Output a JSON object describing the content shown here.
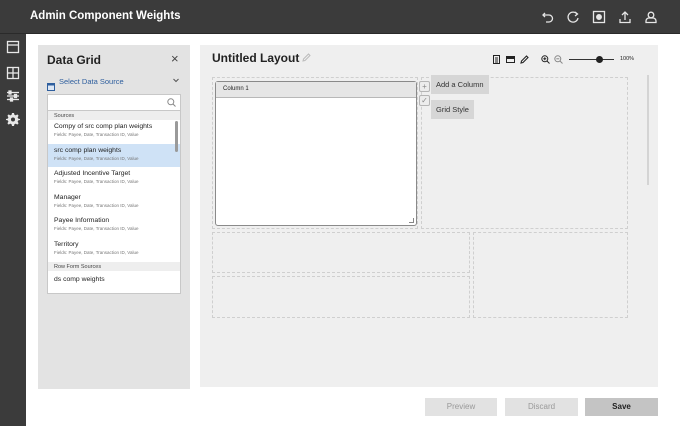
{
  "app": {
    "title": "Admin Component Weights"
  },
  "topbar_icons": [
    "undo-icon",
    "redo-icon",
    "record-icon",
    "upload-icon",
    "user-icon"
  ],
  "rail_icons": [
    "layout-icon",
    "grid-icon",
    "sliders-icon",
    "settings-icon"
  ],
  "panel": {
    "title": "Data Grid",
    "close_glyph": "×",
    "select_source_label": "Select Data Source",
    "search": {
      "value": "",
      "placeholder": ""
    },
    "sections": [
      {
        "header": "Sources",
        "items": [
          {
            "title": "Compy of src comp plan weights",
            "fields": "Fields: Payee, Date, Transaction ID, Value",
            "selected": false
          },
          {
            "title": "src comp plan weights",
            "fields": "Fields: Payee, Date, Transaction ID, Value",
            "selected": true
          },
          {
            "title": "Adjusted Incentive Target",
            "fields": "Fields: Payee, Date, Transaction ID, Value",
            "selected": false
          },
          {
            "title": "Manager",
            "fields": "Fields: Payee, Date, Transaction ID, Value",
            "selected": false
          },
          {
            "title": "Payee Information",
            "fields": "Fields: Payee, Date, Transaction ID, Value",
            "selected": false
          },
          {
            "title": "Territory",
            "fields": "Fields: Payee, Date, Transaction ID, Value",
            "selected": false
          }
        ]
      },
      {
        "header": "Row Form Sources",
        "items": [
          {
            "title": "ds comp weights"
          }
        ]
      }
    ]
  },
  "layout": {
    "title": "Untitled Layout",
    "toolbar_icons": [
      "document-icon",
      "card-icon",
      "pencil-icon",
      "zoom-in-icon",
      "zoom-out-icon"
    ],
    "zoom_value": 100,
    "zoom_label": "100%",
    "column_header": "Column 1",
    "add_column_label": "Add a Column",
    "grid_style_label": "Grid Style"
  },
  "footer": {
    "preview_label": "Preview",
    "discard_label": "Discard",
    "save_label": "Save"
  },
  "colors": {
    "chrome": "#3b3b3b",
    "selected_row": "#cfe2f6",
    "link_blue": "#2f5f9e"
  }
}
